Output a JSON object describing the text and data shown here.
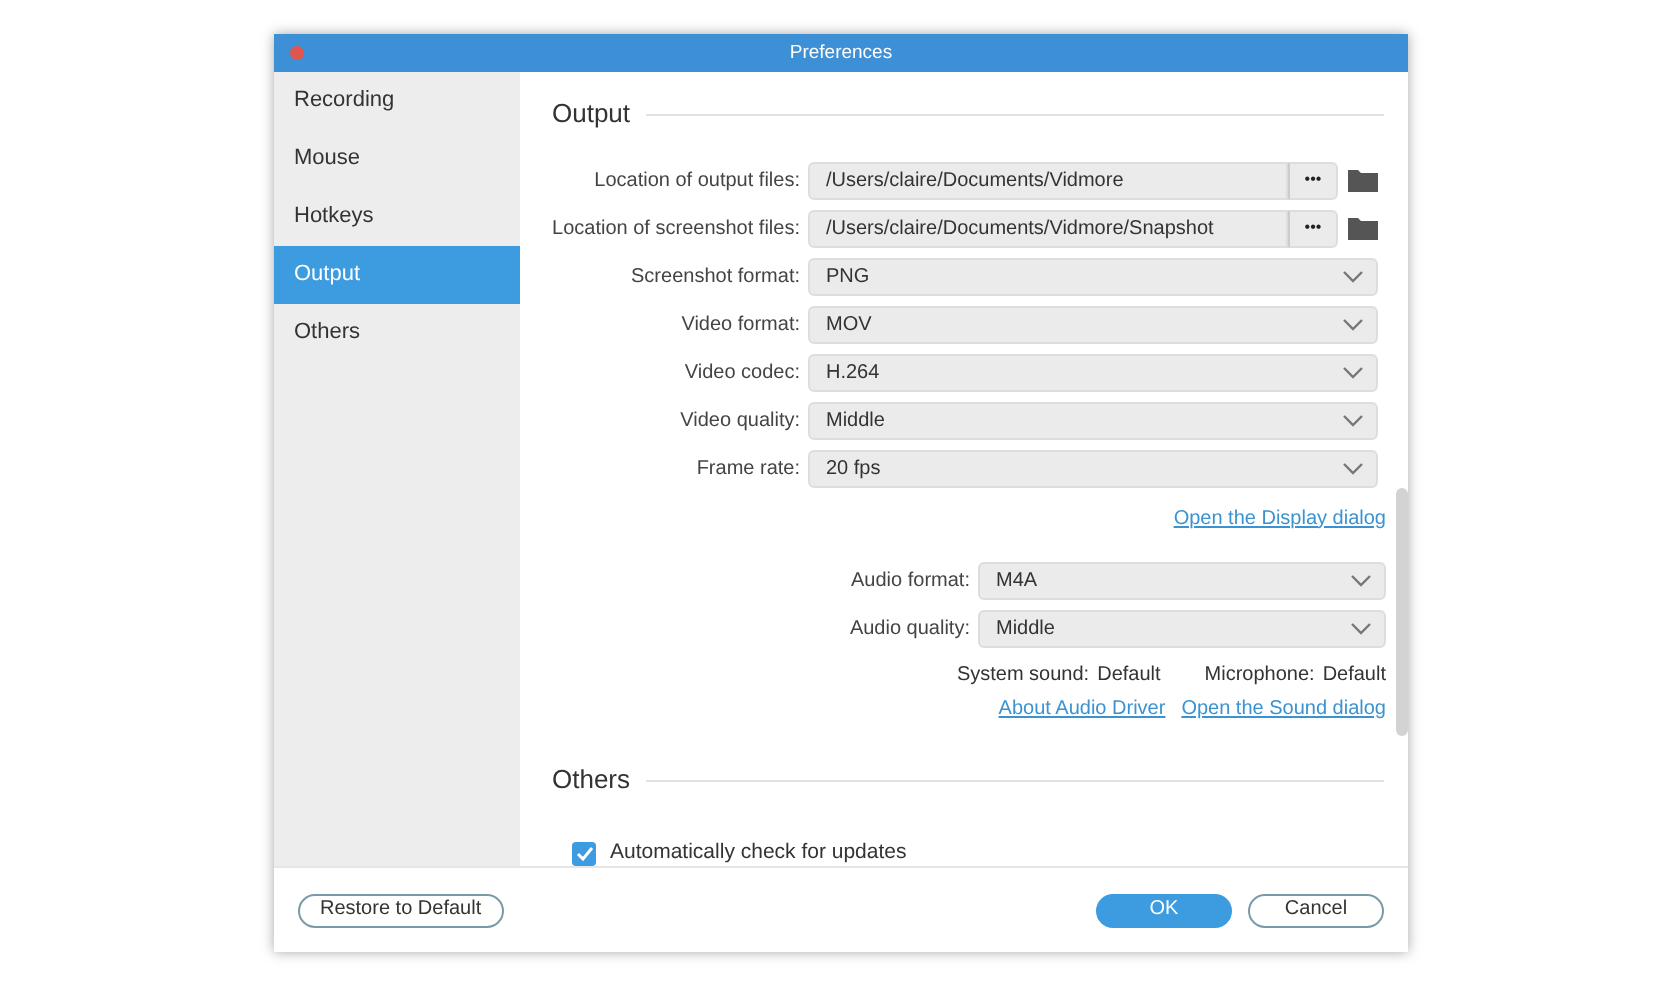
{
  "window": {
    "title": "Preferences"
  },
  "sidebar": {
    "items": [
      {
        "label": "Recording",
        "selected": false
      },
      {
        "label": "Mouse",
        "selected": false
      },
      {
        "label": "Hotkeys",
        "selected": false
      },
      {
        "label": "Output",
        "selected": true
      },
      {
        "label": "Others",
        "selected": false
      }
    ]
  },
  "output": {
    "title": "Output",
    "path_fields": [
      {
        "label": "Location of output files:",
        "value": "/Users/claire/Documents/Vidmore",
        "browse": "•••"
      },
      {
        "label": "Location of screenshot files:",
        "value": "/Users/claire/Documents/Vidmore/Snapshot",
        "browse": "•••"
      }
    ],
    "selects": [
      {
        "label": "Screenshot format:",
        "value": "PNG"
      },
      {
        "label": "Video format:",
        "value": "MOV"
      },
      {
        "label": "Video codec:",
        "value": "H.264"
      },
      {
        "label": "Video quality:",
        "value": "Middle"
      },
      {
        "label": "Frame rate:",
        "value": "20 fps"
      }
    ],
    "display_link": "Open the Display dialog",
    "audio_selects": [
      {
        "label": "Audio format:",
        "value": "M4A"
      },
      {
        "label": "Audio quality:",
        "value": "Middle"
      }
    ],
    "devices": [
      {
        "label": "System sound:",
        "value": "Default"
      },
      {
        "label": "Microphone:",
        "value": "Default"
      }
    ],
    "audio_links": [
      "About Audio Driver",
      "Open the Sound dialog"
    ]
  },
  "others": {
    "title": "Others",
    "checkbox": {
      "label": "Automatically check for updates",
      "checked": true
    }
  },
  "footer": {
    "restore": "Restore to Default",
    "buttons": [
      {
        "label": "OK",
        "kind": "primary"
      },
      {
        "label": "Cancel",
        "kind": "secondary"
      }
    ]
  }
}
